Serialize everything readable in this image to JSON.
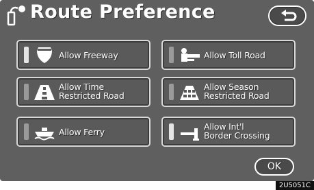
{
  "title": "Route Preference",
  "icons": {
    "title": "route-settings-icon",
    "back": "return-arrow-icon"
  },
  "options": [
    {
      "label": "Allow Freeway",
      "active": true,
      "icon": "freeway-shield-icon"
    },
    {
      "label": "Allow Toll Road",
      "active": false,
      "icon": "toll-booth-icon"
    },
    {
      "label": "Allow Time\nRestricted Road",
      "active": false,
      "icon": "time-restricted-road-icon"
    },
    {
      "label": "Allow Season\nRestricted Road",
      "active": false,
      "icon": "season-restricted-road-icon"
    },
    {
      "label": "Allow Ferry",
      "active": false,
      "icon": "ferry-icon"
    },
    {
      "label": "Allow Int'l\nBorder Crossing",
      "active": true,
      "icon": "border-crossing-icon"
    }
  ],
  "ok_label": "OK",
  "image_code": "2U5051C"
}
